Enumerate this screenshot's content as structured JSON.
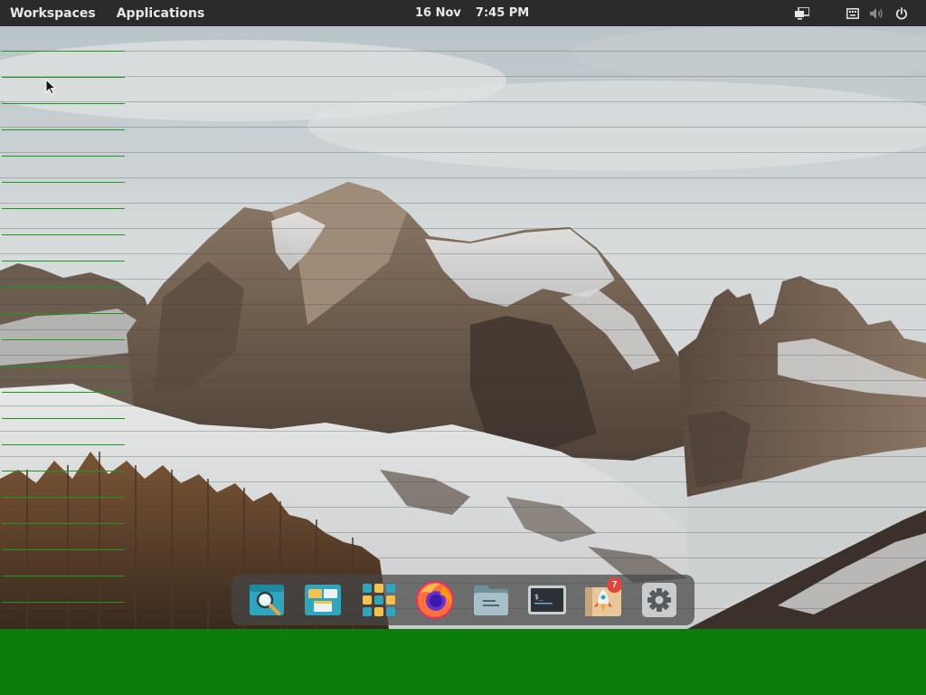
{
  "top_panel": {
    "workspaces_label": "Workspaces",
    "applications_label": "Applications",
    "date": "16 Nov",
    "time": "7:45 PM",
    "indicators": [
      "display-icon",
      "keyboard-icon",
      "volume-muted-icon",
      "power-icon"
    ]
  },
  "dock": {
    "items": [
      {
        "name": "search-app",
        "icon": "magnifier-icon"
      },
      {
        "name": "window-overview",
        "icon": "windows-icon"
      },
      {
        "name": "app-grid",
        "icon": "grid-icon"
      },
      {
        "name": "firefox",
        "icon": "firefox-icon"
      },
      {
        "name": "files",
        "icon": "folder-icon"
      },
      {
        "name": "terminal",
        "icon": "terminal-icon"
      },
      {
        "name": "software-updater",
        "icon": "rocket-icon",
        "badge": "7"
      },
      {
        "name": "settings",
        "icon": "gear-icon"
      }
    ]
  },
  "colors": {
    "panel_bg": "#2b2b2b",
    "green_bar": "#0a7d0a",
    "badge": "#e0443c"
  }
}
